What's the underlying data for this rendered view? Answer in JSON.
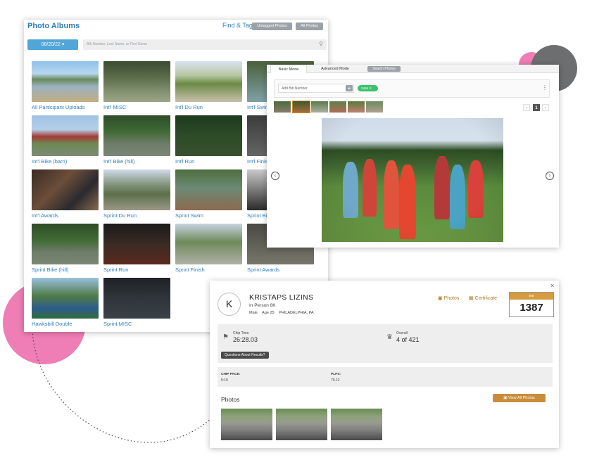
{
  "albums_panel": {
    "title": "Photo Albums",
    "find_tag": "Find & Tag",
    "untagged_label": "Untagged Photos",
    "all_photos_label": "All Photos",
    "date_label": "08/20/22 ▾",
    "search_placeholder": "Bib Number, Last Name, or First Name",
    "albums": [
      {
        "label": "All Participant Uploads"
      },
      {
        "label": "Int'l MISC"
      },
      {
        "label": "Int'l Du Run"
      },
      {
        "label": "Int'l Swim"
      },
      {
        "label": "Int'l Bike (barn)"
      },
      {
        "label": "Int'l Bike (hill)"
      },
      {
        "label": "Int'l Run"
      },
      {
        "label": "Int'l Finish"
      },
      {
        "label": "Int'l Awards"
      },
      {
        "label": "Sprint Du Run"
      },
      {
        "label": "Sprint Swim"
      },
      {
        "label": "Sprint Bike"
      },
      {
        "label": "Sprint Bike (hill)"
      },
      {
        "label": "Sprint Run"
      },
      {
        "label": "Sprint Finish"
      },
      {
        "label": "Sprint Awards"
      },
      {
        "label": "Hawksbill Double"
      },
      {
        "label": "Sprint MISC"
      }
    ]
  },
  "viewer_panel": {
    "tab_basic": "Basic Mode",
    "tab_advanced": "Advanced Mode",
    "search_photos": "Search Photos",
    "bib_placeholder": "Add Bib Number",
    "bib_add": "+",
    "bib_chip": "3446 ✕",
    "page_number": "1",
    "prev": "‹",
    "next": "›",
    "kebab": "⋮"
  },
  "result_panel": {
    "avatar_letter": "K",
    "name": "KRISTAPS LIZINS",
    "event": "In Person 8K",
    "gender": "Male",
    "age": "Age 25",
    "location": "PHILADELPHIA, PA",
    "photos_link": "Photos",
    "certificate_link": "Certificate",
    "bib_header": "BIB",
    "bib_number": "1387",
    "chip_time_label": "Chip Time",
    "chip_time": "26:28.03",
    "overall_label": "Overall",
    "overall": "4 of 421",
    "questions_button": "Questions About Results?",
    "chip_pace_label": "CHIP PACE:",
    "chip_pace": "5:19",
    "plp_label": "PLPS:",
    "plp": "79.12",
    "photos_heading": "Photos",
    "view_all_button": "View All Photos",
    "close": "×"
  },
  "colors": {
    "link_blue": "#2f7fbf",
    "accent_gold": "#c98d3a",
    "pink": "#ee7eb5",
    "gray_circle": "#6d6e70",
    "chip_green": "#3ec26e"
  }
}
